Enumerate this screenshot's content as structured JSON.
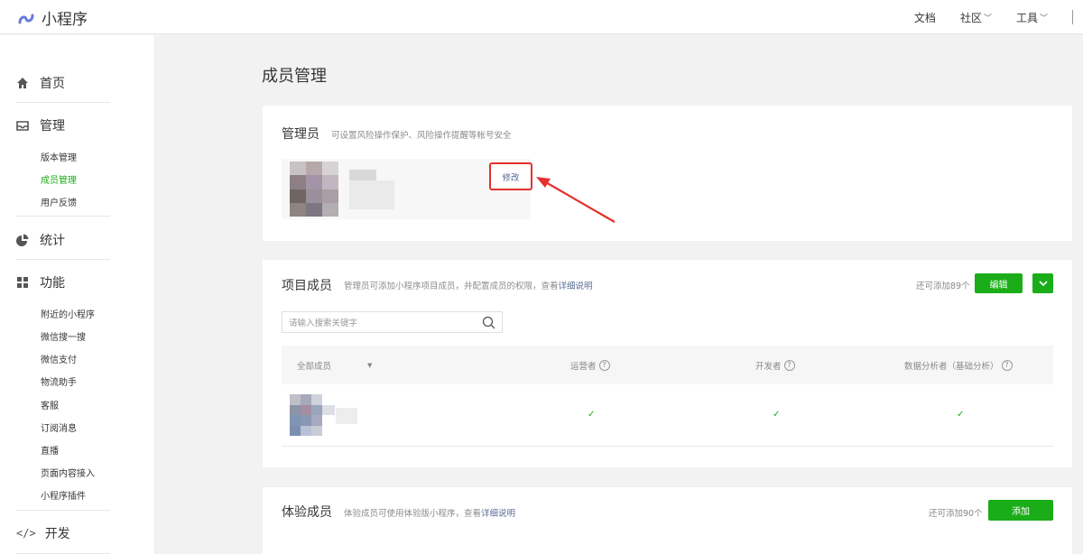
{
  "app": {
    "name": "小程序"
  },
  "topnav": {
    "docs": "文档",
    "community": "社区",
    "tools": "工具"
  },
  "sidebar": {
    "home": "首页",
    "manage": "管理",
    "manage_items": [
      "版本管理",
      "成员管理",
      "用户反馈"
    ],
    "stats": "统计",
    "features": "功能",
    "feature_items": [
      "附近的小程序",
      "微信搜一搜",
      "微信支付",
      "物流助手",
      "客服",
      "订阅消息",
      "直播",
      "页面内容接入",
      "小程序插件"
    ],
    "dev": "开发"
  },
  "page": {
    "title": "成员管理"
  },
  "admin": {
    "title": "管理员",
    "desc": "可设置风险操作保护、风险操作提醒等帐号安全",
    "modify_label": "修改"
  },
  "project": {
    "title": "项目成员",
    "desc_prefix": "管理员可添加小程序项目成员，并配置成员的权限，查看",
    "desc_link": "详细说明",
    "quota": "还可添加89个",
    "edit_label": "编辑",
    "search_placeholder": "请输入搜索关键字",
    "columns": [
      "全部成员",
      "运营者",
      "开发者",
      "数据分析者（基础分析）"
    ],
    "rows": [
      {
        "operator": "✓",
        "developer": "✓",
        "analyst": "✓"
      }
    ]
  },
  "experience": {
    "title": "体验成员",
    "desc_prefix": "体验成员可使用体验版小程序，查看",
    "desc_link": "详细说明",
    "quota": "还可添加90个",
    "add_label": "添加"
  },
  "colors": {
    "brand_green": "#1aad19",
    "link": "#576b95",
    "highlight_red": "#e5302d"
  }
}
